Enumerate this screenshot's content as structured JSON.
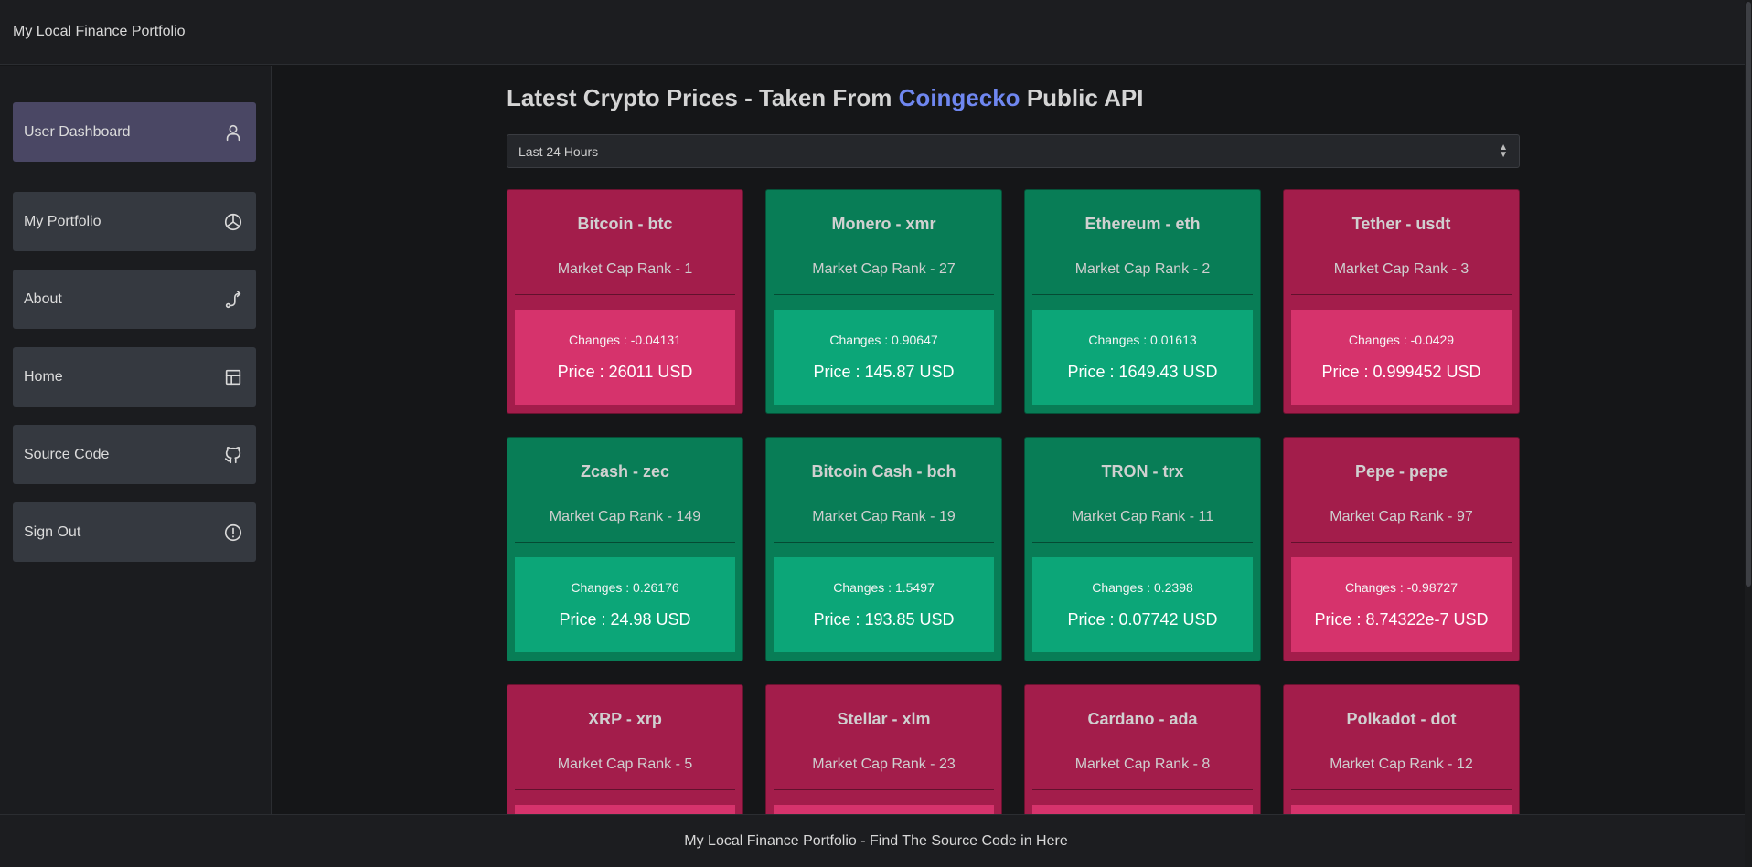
{
  "app": {
    "title": "My Local Finance Portfolio"
  },
  "sidebar": {
    "items": [
      {
        "label": "User Dashboard",
        "icon": "user-icon",
        "active": true
      },
      {
        "label": "My Portfolio",
        "icon": "pie-chart-icon"
      },
      {
        "label": "About",
        "icon": "route-icon"
      },
      {
        "label": "Home",
        "icon": "layout-icon"
      },
      {
        "label": "Source Code",
        "icon": "github-icon"
      },
      {
        "label": "Sign Out",
        "icon": "alert-circle-icon"
      }
    ]
  },
  "main": {
    "heading_prefix": "Latest Crypto Prices - Taken From",
    "heading_accent": "Coingecko",
    "heading_suffix": "Public API",
    "accent_color": "#6f87f0",
    "timeframe": {
      "selected": "Last 24 Hours"
    }
  },
  "colors": {
    "down_card": "#a31d4b",
    "down_box": "#d6336c",
    "up_card": "#087d56",
    "up_box": "#0ca678"
  },
  "coins": [
    {
      "name": "Bitcoin - btc",
      "rank": "Market Cap Rank - 1",
      "changes": "Changes : -0.04131",
      "price": "Price : 26011 USD",
      "trend": "down"
    },
    {
      "name": "Monero - xmr",
      "rank": "Market Cap Rank - 27",
      "changes": "Changes : 0.90647",
      "price": "Price : 145.87 USD",
      "trend": "up"
    },
    {
      "name": "Ethereum - eth",
      "rank": "Market Cap Rank - 2",
      "changes": "Changes : 0.01613",
      "price": "Price : 1649.43 USD",
      "trend": "up"
    },
    {
      "name": "Tether - usdt",
      "rank": "Market Cap Rank - 3",
      "changes": "Changes : -0.0429",
      "price": "Price : 0.999452 USD",
      "trend": "down"
    },
    {
      "name": "Zcash - zec",
      "rank": "Market Cap Rank - 149",
      "changes": "Changes : 0.26176",
      "price": "Price : 24.98 USD",
      "trend": "up"
    },
    {
      "name": "Bitcoin Cash - bch",
      "rank": "Market Cap Rank - 19",
      "changes": "Changes : 1.5497",
      "price": "Price : 193.85 USD",
      "trend": "up"
    },
    {
      "name": "TRON - trx",
      "rank": "Market Cap Rank - 11",
      "changes": "Changes : 0.2398",
      "price": "Price : 0.07742 USD",
      "trend": "up"
    },
    {
      "name": "Pepe - pepe",
      "rank": "Market Cap Rank - 97",
      "changes": "Changes : -0.98727",
      "price": "Price : 8.74322e-7 USD",
      "trend": "down"
    },
    {
      "name": "XRP - xrp",
      "rank": "Market Cap Rank - 5",
      "trend": "down"
    },
    {
      "name": "Stellar - xlm",
      "rank": "Market Cap Rank - 23",
      "trend": "down"
    },
    {
      "name": "Cardano - ada",
      "rank": "Market Cap Rank - 8",
      "trend": "down"
    },
    {
      "name": "Polkadot - dot",
      "rank": "Market Cap Rank - 12",
      "trend": "down"
    }
  ],
  "footer": {
    "text": "My Local Finance Portfolio - Find The Source Code in Here"
  }
}
